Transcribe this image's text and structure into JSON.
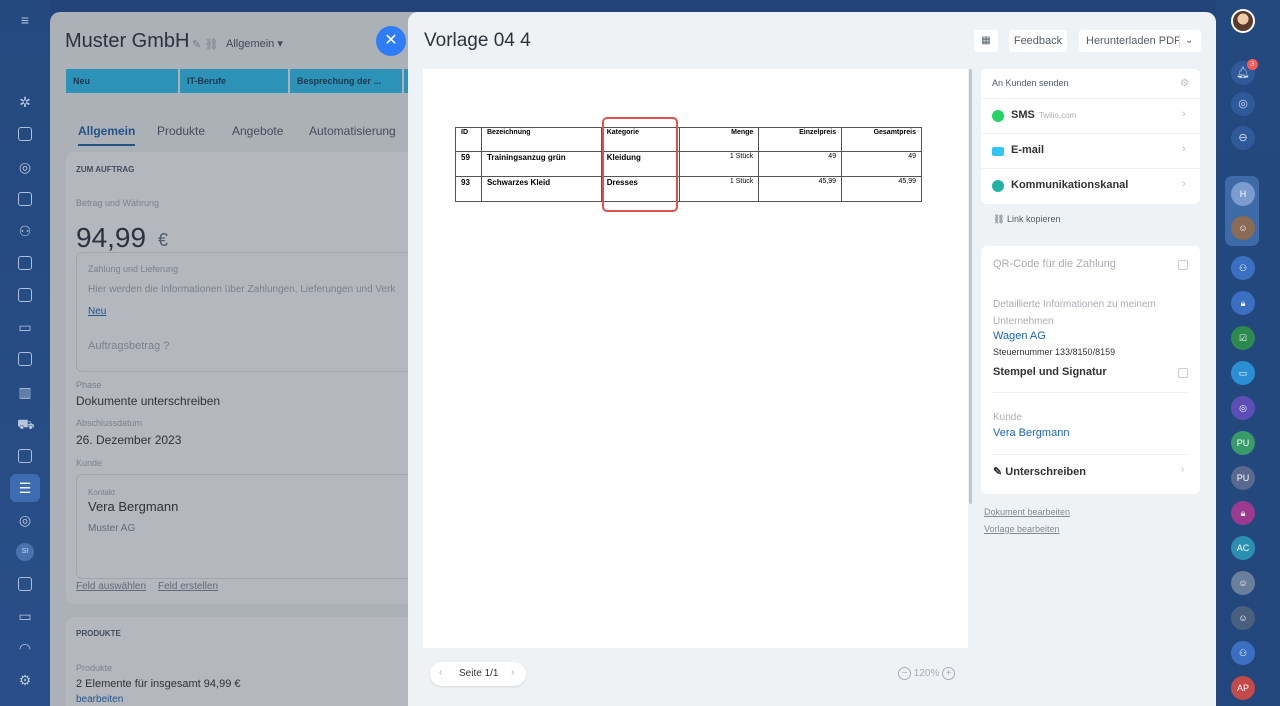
{
  "crm": {
    "company": "Muster GmbH",
    "category": "Allgemein",
    "stages": [
      "Neu",
      "IT-Berufe",
      "Besprechung der ..."
    ],
    "tabs": [
      "Allgemein",
      "Produkte",
      "Angebote",
      "Automatisierung"
    ],
    "order_section": "ZUM AUFTRAG",
    "amount_label": "Betrag und Währung",
    "amount": "94,99",
    "currency": "€",
    "payment_label": "Zahlung und Lieferung",
    "payment_text": "Hier werden die Informationen über Zahlungen, Lieferungen und Verk",
    "payment_new": "Neu",
    "order_amount": "Auftragsbetrag",
    "phase_label": "Phase",
    "phase": "Dokumente unterschreiben",
    "close_date_label": "Abschlussdatum",
    "close_date": "26. Dezember 2023",
    "client_label": "Kunde",
    "contact_label": "Kontakt",
    "contact_name": "Vera Bergmann",
    "contact_company": "Muster AG",
    "select_field": "Feld auswählen",
    "create_field": "Feld erstellen",
    "products_section": "PRODUKTE",
    "products_label": "Produkte",
    "products_summary": "2 Elemente für insgesamt 94,99 €",
    "products_edit": "bearbeiten"
  },
  "modal": {
    "title": "Vorlage 04 4",
    "feedback": "Feedback",
    "download": "Herunterladen PDF",
    "table": {
      "headers": [
        "ID",
        "Bezeichnung",
        "Kategorie",
        "Menge",
        "Einzelpreis",
        "Gesamtpreis"
      ],
      "rows": [
        {
          "id": "59",
          "name": "Trainingsanzug grün",
          "category": "Kleidung",
          "qty": "1 Stück",
          "unit": "49",
          "total": "49"
        },
        {
          "id": "93",
          "name": "Schwarzes Kleid",
          "category": "Dresses",
          "qty": "1 Stück",
          "unit": "45,99",
          "total": "45,99"
        }
      ]
    },
    "page": "Seite 1/1",
    "zoom": "120%"
  },
  "panel": {
    "send_title": "An Kunden senden",
    "sms": "SMS",
    "sms_provider": "Twilio.com",
    "email": "E-mail",
    "channel": "Kommunikationskanal",
    "copy_link": "Link kopieren",
    "qr": "QR-Code für die Zahlung",
    "company_info": "Detaillierte Informationen zu meinem Unternehmen",
    "company_name": "Wagen AG",
    "tax": "Steuernummer 133/8150/8159",
    "stamp": "Stempel und Signatur",
    "client_label": "Kunde",
    "client_name": "Vera Bergmann",
    "sign": "Unterschreiben",
    "edit_doc": "Dokument bearbeiten",
    "edit_template": "Vorlage bearbeiten"
  },
  "right_rail": {
    "badge": "3",
    "avatars": [
      "PU",
      "PU",
      "AC",
      "AP"
    ]
  },
  "left_rail": {
    "si": "SI"
  },
  "colors": {
    "accent": "#2067b0",
    "stage": "#2fc6f6",
    "highlight": "#e0524e",
    "close": "#2f7df6"
  }
}
